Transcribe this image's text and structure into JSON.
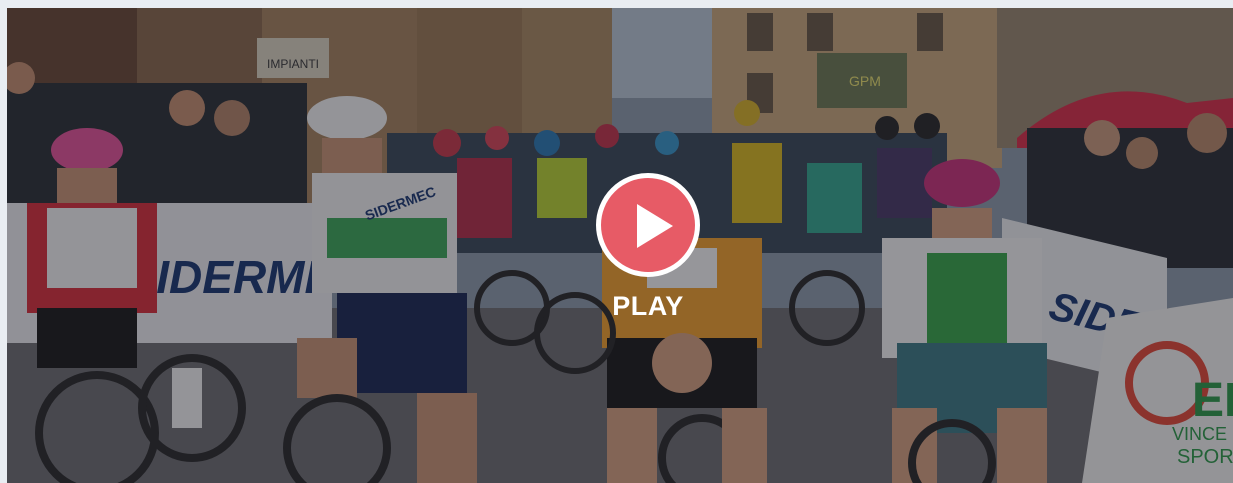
{
  "video": {
    "play_label": "PLAY",
    "accent_color": "#e75b66"
  },
  "scene": {
    "banner_left": "SIDERMEC",
    "banner_right": "SIDERMEC",
    "sponsor_er": "ER",
    "sponsor_tagline_1": "VINCE LO",
    "sponsor_tagline_2": "SPORT",
    "shop_sign": "IMPIANTI",
    "jersey_text": "SIDERMEC",
    "gpm_sign": "GPM"
  }
}
